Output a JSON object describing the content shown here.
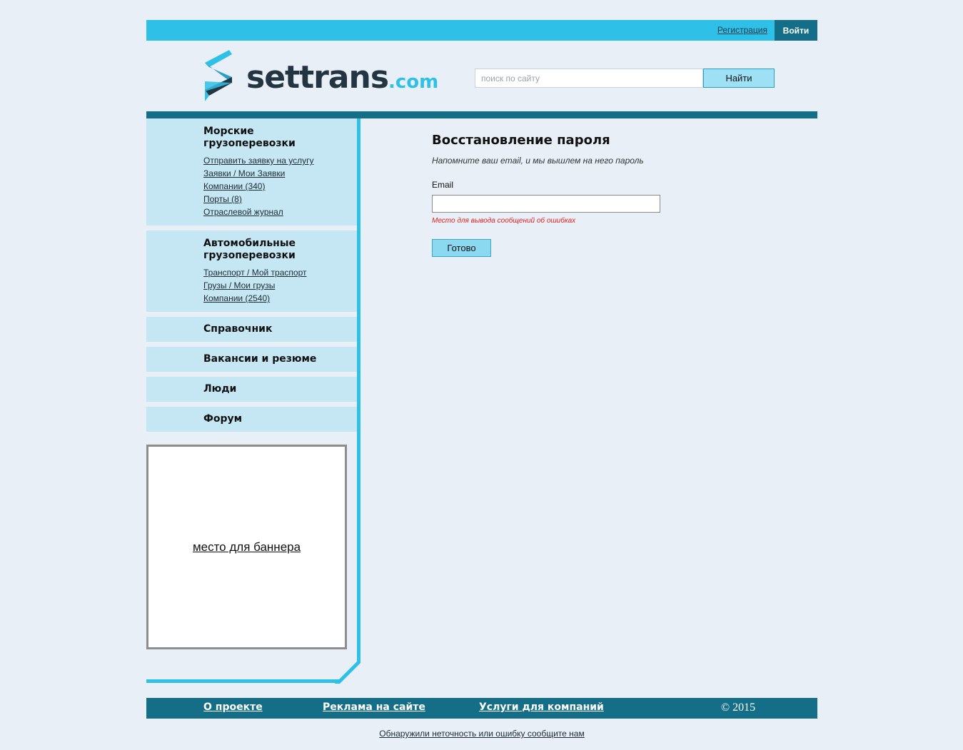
{
  "topbar": {
    "register": "Регистрация",
    "login": "Войти"
  },
  "logo": {
    "word": "settrans",
    "domain": ".com"
  },
  "search": {
    "placeholder": "поиск по сайту",
    "button": "Найти"
  },
  "sidebar": {
    "sea": {
      "title": "Морские грузоперевозки",
      "links": [
        "Отправить заявку на услугу",
        "Заявки / Мои Заявки",
        "Компании (340)",
        "Порты (8)",
        "Отраслевой журнал"
      ]
    },
    "auto": {
      "title": "Автомобильные грузоперевозки",
      "links": [
        "Транспорт / Мой траспорт",
        "Грузы / Мои грузы",
        "Компании (2540)"
      ]
    },
    "items": [
      "Справочник",
      "Вакансии и резюме",
      "Люди",
      "Форум"
    ],
    "banner": "место для баннера"
  },
  "main": {
    "title": "Восстановление пароля",
    "subtitle": "Напомните ваш email, и мы вышлем на него пароль",
    "email_label": "Email",
    "email_value": "",
    "error_text": "Место для вывода сообщений об ошибках",
    "submit": "Готово"
  },
  "footer": {
    "about": "О проекте",
    "ads": "Реклама на сайте",
    "services": "Услуги для компаний",
    "copyright": "© 2015",
    "report": "Обнаружили неточность или ошибку сообщите нам"
  },
  "colors": {
    "accent": "#2ec0e7",
    "dark": "#146e87",
    "panel": "#c5e7f3",
    "background": "#e8eff6"
  }
}
